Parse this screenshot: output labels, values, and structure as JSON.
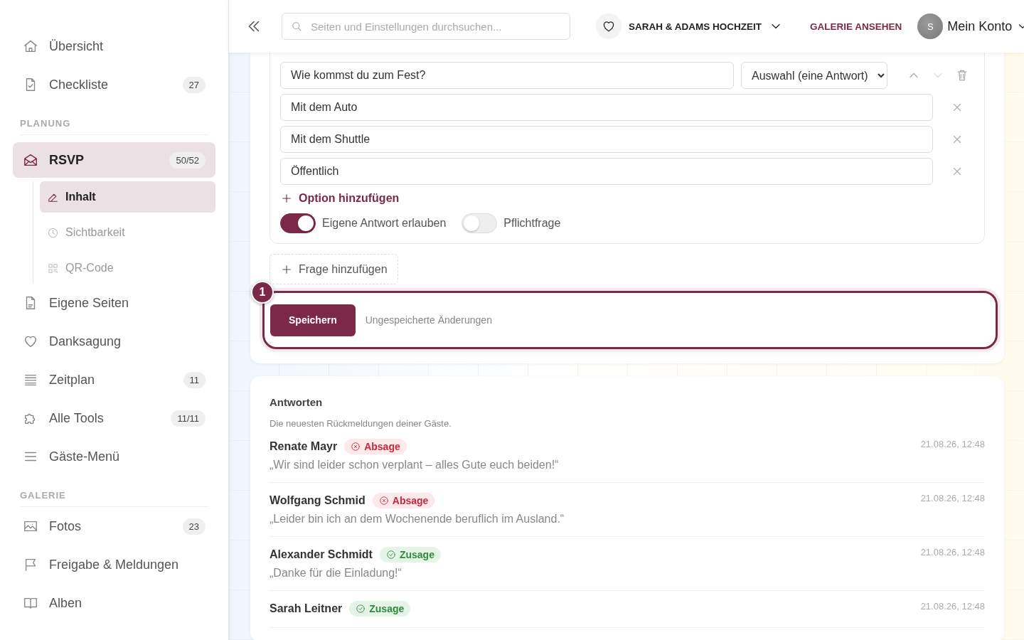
{
  "sidebar": {
    "sections": [
      {
        "items": [
          {
            "label": "Übersicht",
            "selected": false
          },
          {
            "label": "Checkliste",
            "badge": "27",
            "selected": false
          }
        ]
      },
      {
        "label": "PLANUNG",
        "items": [
          {
            "label": "RSVP",
            "badge": "50/52",
            "selected": true,
            "children": [
              {
                "label": "Inhalt",
                "selected": true
              },
              {
                "label": "Sichtbarkeit",
                "selected": false
              },
              {
                "label": "QR-Code",
                "selected": false
              }
            ]
          },
          {
            "label": "Eigene Seiten",
            "selected": false
          },
          {
            "label": "Danksagung",
            "selected": false
          },
          {
            "label": "Zeitplan",
            "badge": "11",
            "selected": false
          },
          {
            "label": "Alle Tools",
            "badge": "11/11",
            "selected": false
          },
          {
            "label": "Gäste-Menü",
            "selected": false
          }
        ]
      },
      {
        "label": "GALERIE",
        "items": [
          {
            "label": "Fotos",
            "badge": "23",
            "selected": false
          },
          {
            "label": "Freigabe & Meldungen",
            "selected": false
          },
          {
            "label": "Alben",
            "selected": false
          }
        ]
      }
    ]
  },
  "header": {
    "search": {
      "placeholder": "Seiten und Einstellungen durchsuchen..."
    },
    "event": "SARAH & ADAMS HOCHZEIT",
    "gallery_link": "GALERIE ANSEHEN",
    "account": {
      "initial": "S",
      "label": "Mein Konto"
    }
  },
  "question": {
    "text": "Wie kommst du zum Fest?",
    "type": "Auswahl (eine Antwort)",
    "actions": [
      {
        "kind": "up",
        "disabled": false
      },
      {
        "kind": "down",
        "disabled": true
      },
      {
        "kind": "delete",
        "disabled": false
      }
    ],
    "options": [
      "Mit dem Auto",
      "Mit dem Shuttle",
      "Öffentlich"
    ],
    "add_option": "Option hinzufügen",
    "toggles": [
      {
        "label": "Eigene Antwort erlauben",
        "on": true
      },
      {
        "label": "Pflichtfrage",
        "on": false
      }
    ]
  },
  "add_question": "Frage hinzufügen",
  "save_bar": {
    "step": "1",
    "button": "Speichern",
    "status": "Ungespeicherte Änderungen"
  },
  "answers": {
    "title": "Antworten",
    "subtitle": "Die neuesten Rückmeldungen deiner Gäste.",
    "rows": [
      {
        "name": "Renate Mayr",
        "status": {
          "kind": "decline",
          "label": "Absage"
        },
        "message": "„Wir sind leider schon verplant – alles Gute euch beiden!“",
        "time": "21.08.26, 12:48"
      },
      {
        "name": "Wolfgang Schmid",
        "status": {
          "kind": "decline",
          "label": "Absage"
        },
        "message": "„Leider bin ich an dem Wochenende beruflich im Ausland.“",
        "time": "21.08.26, 12:48"
      },
      {
        "name": "Alexander Schmidt",
        "status": {
          "kind": "accept",
          "label": "Zusage"
        },
        "message": "„Danke für die Einladung!“",
        "time": "21.08.26, 12:48"
      },
      {
        "name": "Sarah Leitner",
        "status": {
          "kind": "accept",
          "label": "Zusage"
        },
        "time": "21.08.26, 12:48"
      }
    ]
  }
}
